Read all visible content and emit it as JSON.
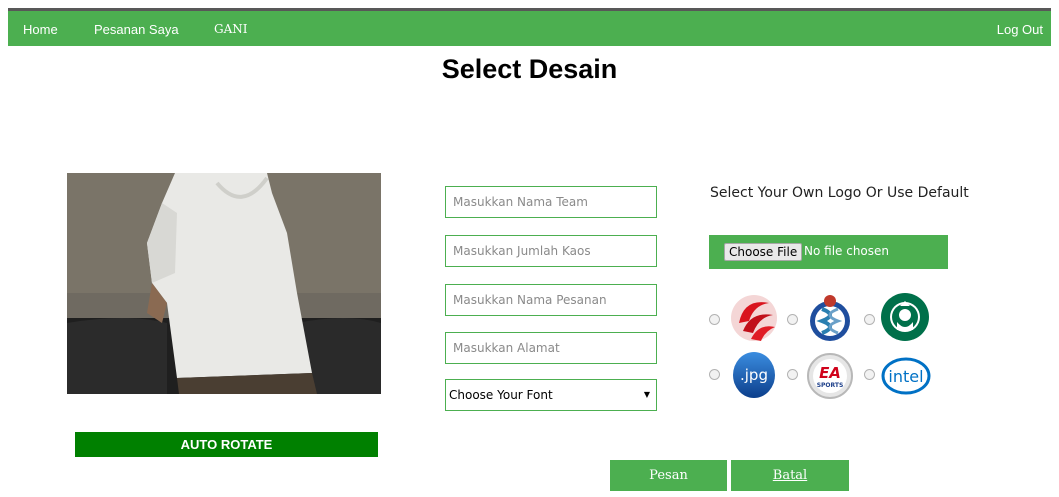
{
  "nav": {
    "home": "Home",
    "orders": "Pesanan Saya",
    "user": "GANI",
    "logout": "Log Out"
  },
  "page": {
    "title": "Select Desain"
  },
  "preview": {
    "rotate_label": "AUTO ROTATE"
  },
  "form": {
    "team_placeholder": "Masukkan Nama Team",
    "qty_placeholder": "Masukkan Jumlah Kaos",
    "order_name_placeholder": "Masukkan Nama Pesanan",
    "address_placeholder": "Masukkan Alamat",
    "font_selected": "Choose Your Font"
  },
  "logo_picker": {
    "heading": "Select Your Own Logo Or Use Default",
    "choose_file": "Choose File",
    "file_status": "No file chosen",
    "options": [
      "red-swirl-logo",
      "dna-helix-logo",
      "starbucks-logo",
      "jpg-logo",
      "ea-sports-logo",
      "intel-logo"
    ],
    "jpg_text": ".jpg",
    "ea_text": "EA",
    "ea_sub": "SPORTS",
    "intel_text": "intel"
  },
  "actions": {
    "submit": "Pesan",
    "cancel": "Batal"
  },
  "colors": {
    "brand_green": "#4caf50",
    "rotate_green": "#008000"
  }
}
